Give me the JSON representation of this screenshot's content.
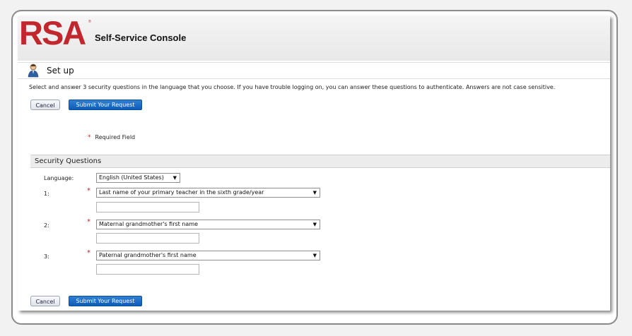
{
  "header": {
    "logo_text": "RSA",
    "logo_registered": "®",
    "app_title": "Self-Service Console"
  },
  "setup": {
    "title": "Set up",
    "icon": "user-icon"
  },
  "instructions": "Select and answer 3  security questions in the language that you choose. If you have trouble logging on, you can answer these questions to authenticate. Answers are not case sensitive.",
  "buttons": {
    "cancel": "Cancel",
    "submit": "Submit Your Request"
  },
  "required_field": {
    "marker": "*",
    "label": "Required Field"
  },
  "security": {
    "section_title": "Security Questions",
    "language_label": "Language:",
    "language_value": "English (United States)",
    "questions": [
      {
        "label": "1:",
        "marker": "*",
        "question": "Last name of your primary teacher in the sixth grade/year",
        "answer": ""
      },
      {
        "label": "2:",
        "marker": "*",
        "question": "Maternal grandmother's first name",
        "answer": ""
      },
      {
        "label": "3:",
        "marker": "*",
        "question": "Paternal grandmother's first name",
        "answer": ""
      }
    ]
  },
  "colors": {
    "brand_red": "#c1272d",
    "submit_blue": "#0b5cb8"
  }
}
